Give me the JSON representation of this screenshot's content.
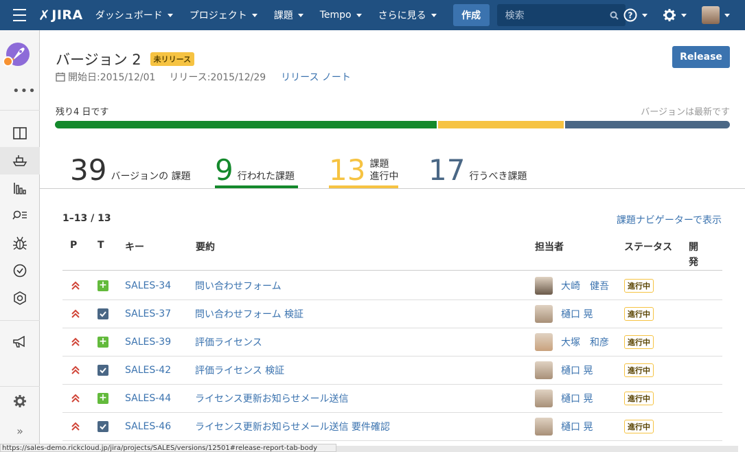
{
  "nav": {
    "logo": "JIRA",
    "items": [
      {
        "label": "ダッシュボード"
      },
      {
        "label": "プロジェクト"
      },
      {
        "label": "課題"
      },
      {
        "label": "Tempo"
      },
      {
        "label": "さらに見る"
      }
    ],
    "create_label": "作成",
    "search_placeholder": "検索"
  },
  "version": {
    "title": "バージョン 2",
    "badge": "未リリース",
    "start": "開始日:2015/12/01",
    "release": "リリース:2015/12/29",
    "notes_link": "リリース ノート",
    "release_button": "Release",
    "remaining": "残り4 日です",
    "latest": "バージョンは最新です",
    "progress": {
      "done": 39,
      "in_progress": 13,
      "todo": 17,
      "done_color": "#14892c",
      "in_progress_color": "#f6c342",
      "todo_color": "#4a6785"
    }
  },
  "stats": [
    {
      "num": "39",
      "label": "バージョンの 課題",
      "color": "#333333"
    },
    {
      "num": "9",
      "label": "行われた課題",
      "color": "#14892c"
    },
    {
      "num": "13",
      "label": "課題 進行中",
      "label_line1": "課題",
      "label_line2": "進行中",
      "color": "#f6c342"
    },
    {
      "num": "17",
      "label": "行うべき課題",
      "color": "#4a6785"
    }
  ],
  "table": {
    "pager": "1–13 / 13",
    "navigator_link": "課題ナビゲーターで表示",
    "headers": {
      "p": "P",
      "t": "T",
      "key": "キー",
      "summary": "要約",
      "assignee": "担当者",
      "status": "ステータス",
      "dev_line1": "開",
      "dev_line2": "発"
    },
    "rows": [
      {
        "type": "story",
        "key": "SALES-34",
        "summary": "問い合わせフォーム",
        "assignee": "大崎　健吾",
        "status": "進行中",
        "avatar_color": "#6b5a4a"
      },
      {
        "type": "task",
        "key": "SALES-37",
        "summary": "問い合わせフォーム 検証",
        "assignee": "樋口 晃",
        "status": "進行中",
        "avatar_color": "#a89078"
      },
      {
        "type": "story",
        "key": "SALES-39",
        "summary": "評価ライセンス",
        "assignee": "大塚　和彦",
        "status": "進行中",
        "avatar_color": "#c9a27d"
      },
      {
        "type": "task",
        "key": "SALES-42",
        "summary": "評価ライセンス 検証",
        "assignee": "樋口 晃",
        "status": "進行中",
        "avatar_color": "#a89078"
      },
      {
        "type": "story",
        "key": "SALES-44",
        "summary": "ライセンス更新お知らせメール送信",
        "assignee": "樋口 晃",
        "status": "進行中",
        "avatar_color": "#a89078"
      },
      {
        "type": "task",
        "key": "SALES-46",
        "summary": "ライセンス更新お知らせメール送信 要件確認",
        "assignee": "樋口 晃",
        "status": "進行中",
        "avatar_color": "#a89078"
      }
    ]
  },
  "statusbar": "https://sales-demo.rickcloud.jp/jira/projects/SALES/versions/12501#release-report-tab-body"
}
